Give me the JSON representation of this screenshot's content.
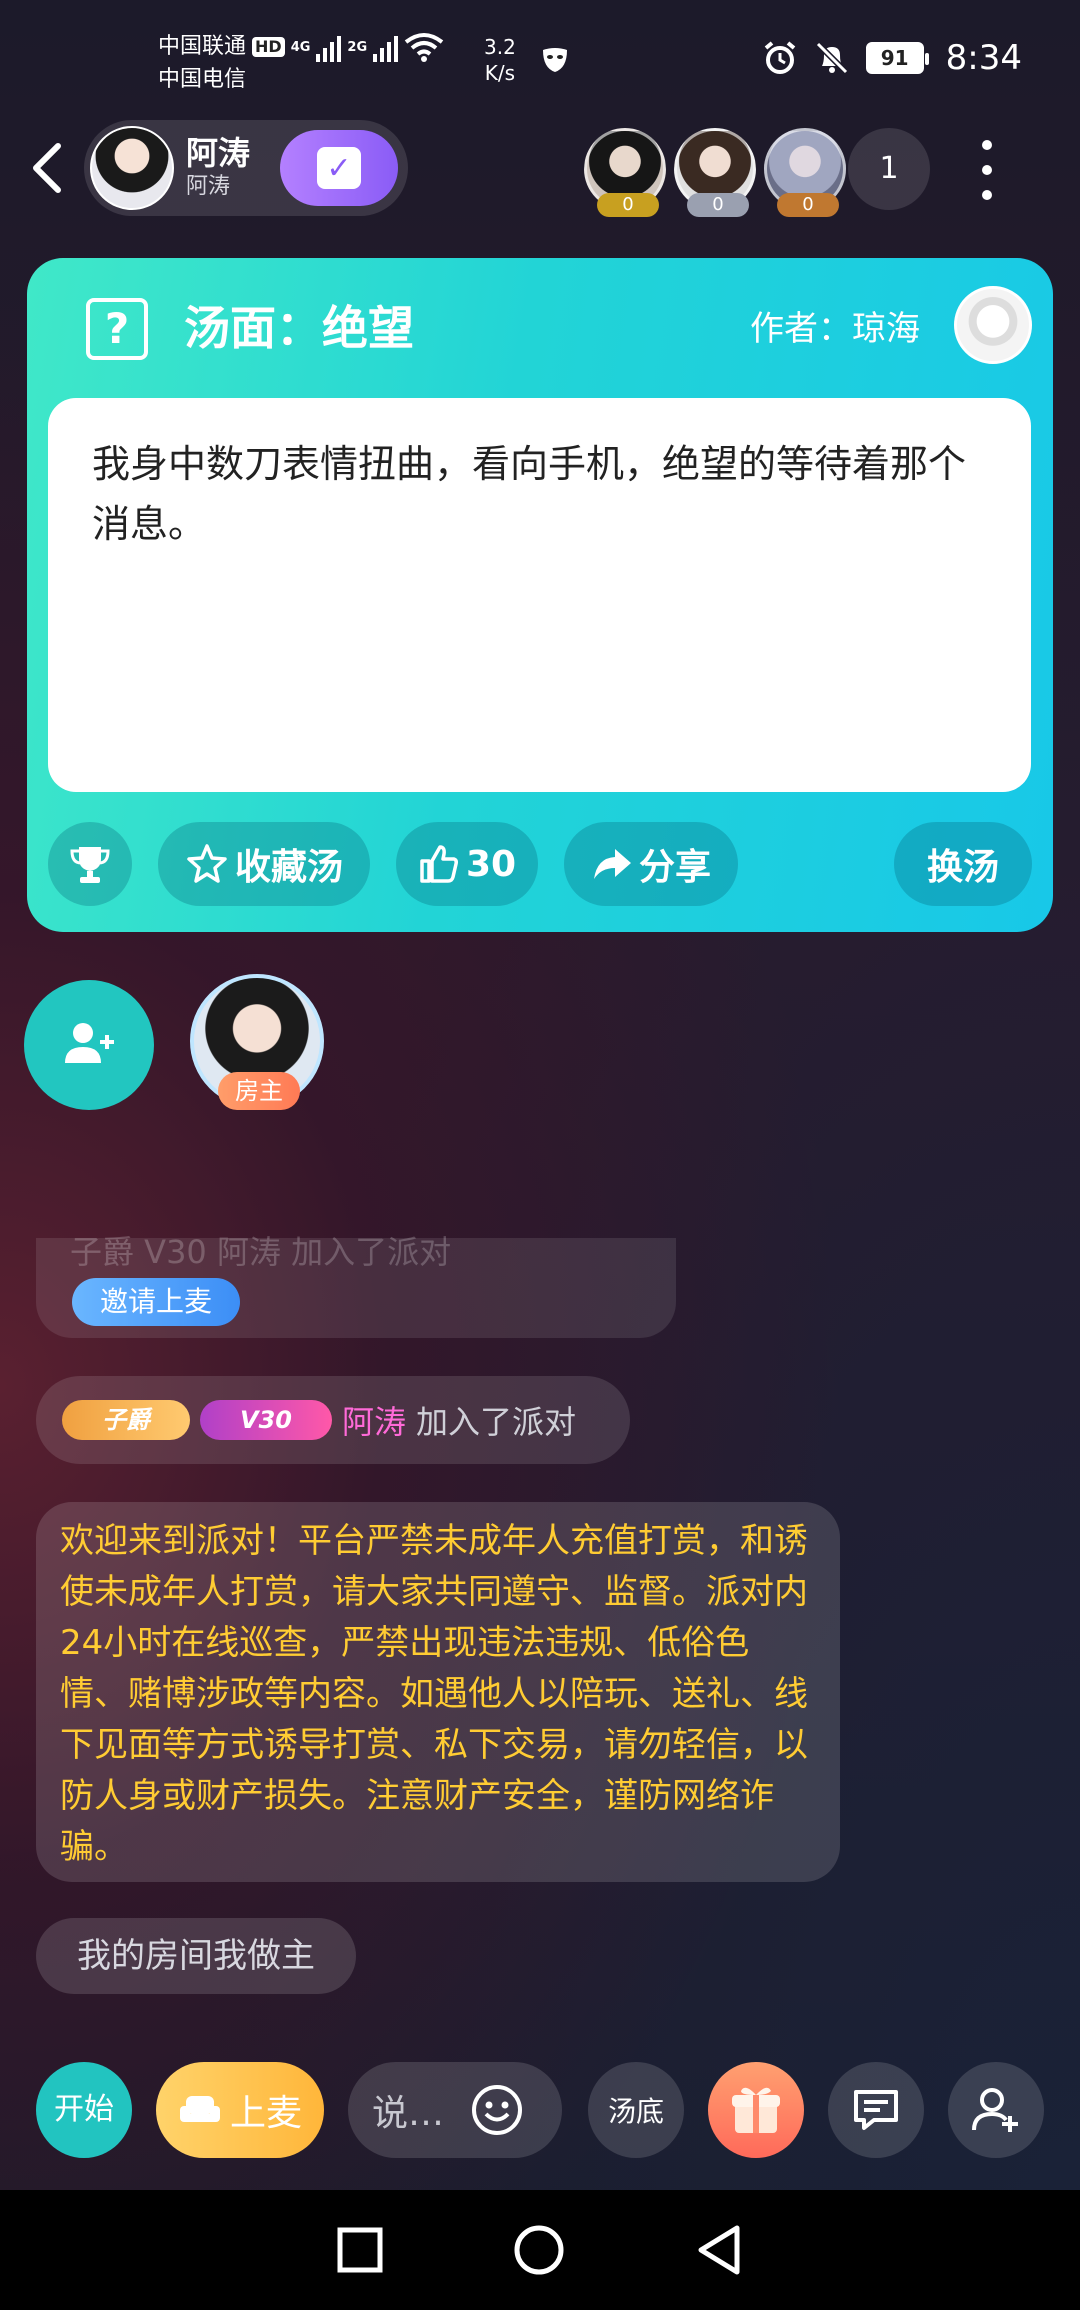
{
  "status_bar": {
    "carrier1": "中国联通",
    "carrier1_badge": "HD",
    "carrier2": "中国电信",
    "net1": "4G",
    "net2": "2G",
    "speed_value": "3.2",
    "speed_unit": "K/s",
    "battery": "91",
    "time": "8:34"
  },
  "header": {
    "host_name": "阿涛",
    "host_subtitle": "阿涛",
    "viewers": [
      {
        "badge": "0",
        "badge_color": "#c8a020"
      },
      {
        "badge": "0",
        "badge_color": "#9aa0b0"
      },
      {
        "badge": "0",
        "badge_color": "#c07830"
      }
    ],
    "viewer_count": "1"
  },
  "card": {
    "title": "汤面：绝望",
    "author": "作者：琼海",
    "story": "我身中数刀表情扭曲，看向手机，绝望的等待着那个消息。",
    "favorite_label": "收藏汤",
    "like_count": "30",
    "share_label": "分享",
    "change_label": "换汤"
  },
  "seats": {
    "host_tag": "房主"
  },
  "chat": {
    "partial_text": "子爵  V30  阿涛  加入了派对",
    "invite_label": "邀请上麦",
    "join_badge_rank": "子爵",
    "join_badge_level": "V30",
    "join_name": "阿涛",
    "join_action": "加入了派对",
    "notice": "欢迎来到派对！平台严禁未成年人充值打赏，和诱使未成年人打赏，请大家共同遵守、监督。派对内24小时在线巡查，严禁出现违法违规、低俗色情、赌博涉政等内容。如遇他人以陪玩、送礼、线下见面等方式诱导打赏、私下交易，请勿轻信，以防人身或财产损失。注意财产安全，谨防网络诈骗。",
    "room_message": "我的房间我做主"
  },
  "toolbar": {
    "start_label": "开始",
    "mic_label": "上麦",
    "input_placeholder": "说…",
    "answer_label": "汤底"
  },
  "colors": {
    "card_accent": "#22d4d6",
    "notice_text": "#ffcc33",
    "join_name": "#ff6ad8"
  }
}
